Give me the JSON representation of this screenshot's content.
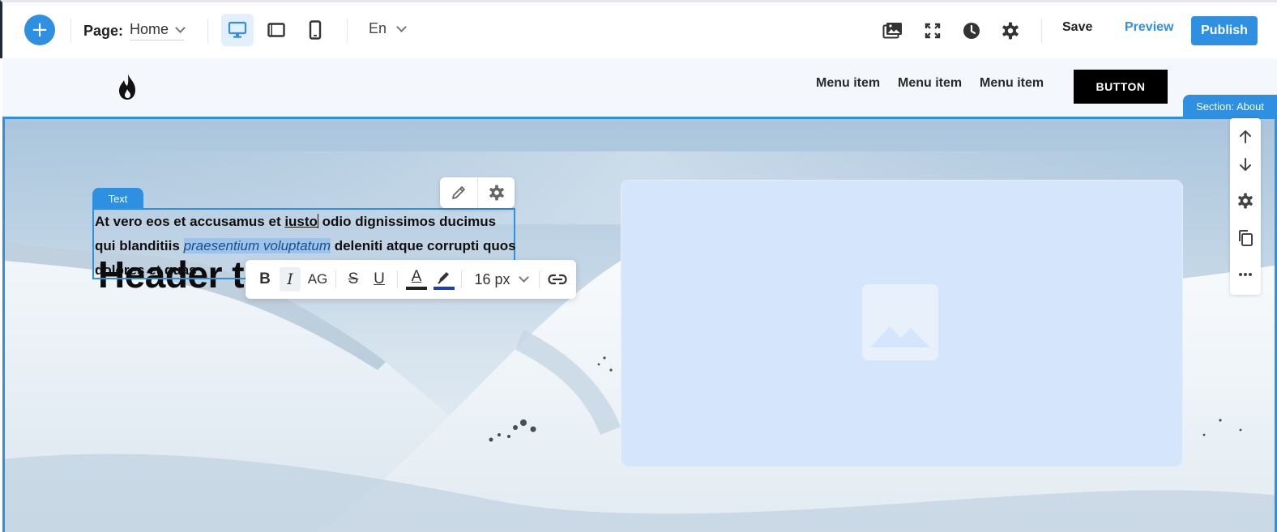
{
  "toolbar": {
    "add_icon": "plus-icon",
    "page_label": "Page:",
    "page_value": "Home",
    "devices": [
      {
        "name": "desktop",
        "icon": "desktop-icon",
        "active": true
      },
      {
        "name": "tablet",
        "icon": "tablet-icon",
        "active": false
      },
      {
        "name": "mobile",
        "icon": "mobile-icon",
        "active": false
      }
    ],
    "language": "En",
    "icons": [
      "media-library-icon",
      "fullscreen-icon",
      "history-icon",
      "settings-icon"
    ],
    "save_label": "Save",
    "preview_label": "Preview",
    "publish_label": "Publish",
    "accent_color": "#2f8fe0"
  },
  "site_header": {
    "logo_icon": "flame-icon",
    "menu": [
      "Menu item",
      "Menu item",
      "Menu item"
    ],
    "button_label": "BUTTON"
  },
  "section_badge": "Section: About",
  "hero": {
    "title": "Header text",
    "text_tag": "Text",
    "paragraph": {
      "part1": "At vero eos et accusamus et ",
      "underlined": "iusto",
      "part2": " odio dignissimos ducimus qui blanditiis ",
      "selected": "praesentium voluptatum",
      "part3": " deleniti atque corrupti quos dolores et quas"
    },
    "image_placeholder_icon": "image-placeholder-icon"
  },
  "text_tools": [
    "edit-icon",
    "settings-icon"
  ],
  "format_bar": {
    "bold": "B",
    "italic": "I",
    "caps": "AG",
    "strike": "S",
    "underline": "U",
    "text_color_label": "A",
    "font_size": "16 px",
    "text_color": "#222222",
    "highlight_color": "#1d3fb0"
  },
  "side_panel": [
    "arrow-up-icon",
    "arrow-down-icon",
    "settings-icon",
    "duplicate-icon",
    "more-icon"
  ]
}
